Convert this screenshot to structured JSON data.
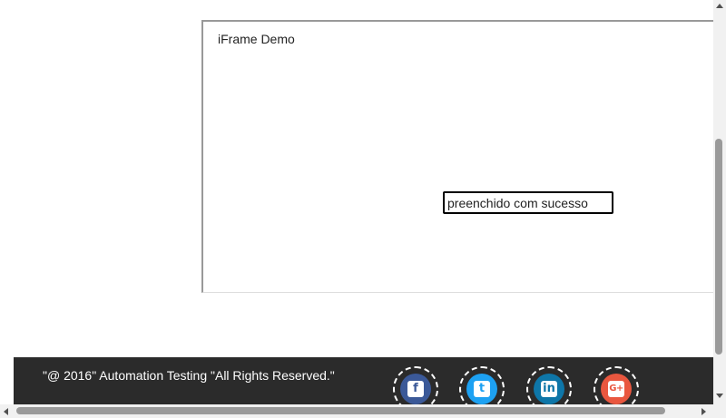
{
  "iframe": {
    "title": "iFrame Demo",
    "input_value": "preenchido com sucesso"
  },
  "footer": {
    "copyright": "\"@ 2016\" Automation Testing \"All Rights Reserved.\"",
    "social": [
      {
        "icon": "facebook-icon",
        "glyph": "f",
        "color": "#3b5998"
      },
      {
        "icon": "twitter-icon",
        "glyph": "t",
        "color": "#1da1f2"
      },
      {
        "icon": "linkedin-icon",
        "glyph": "in",
        "color": "#0e76a8"
      },
      {
        "icon": "google-plus-icon",
        "glyph": "G+",
        "color": "#e9573f"
      }
    ]
  }
}
